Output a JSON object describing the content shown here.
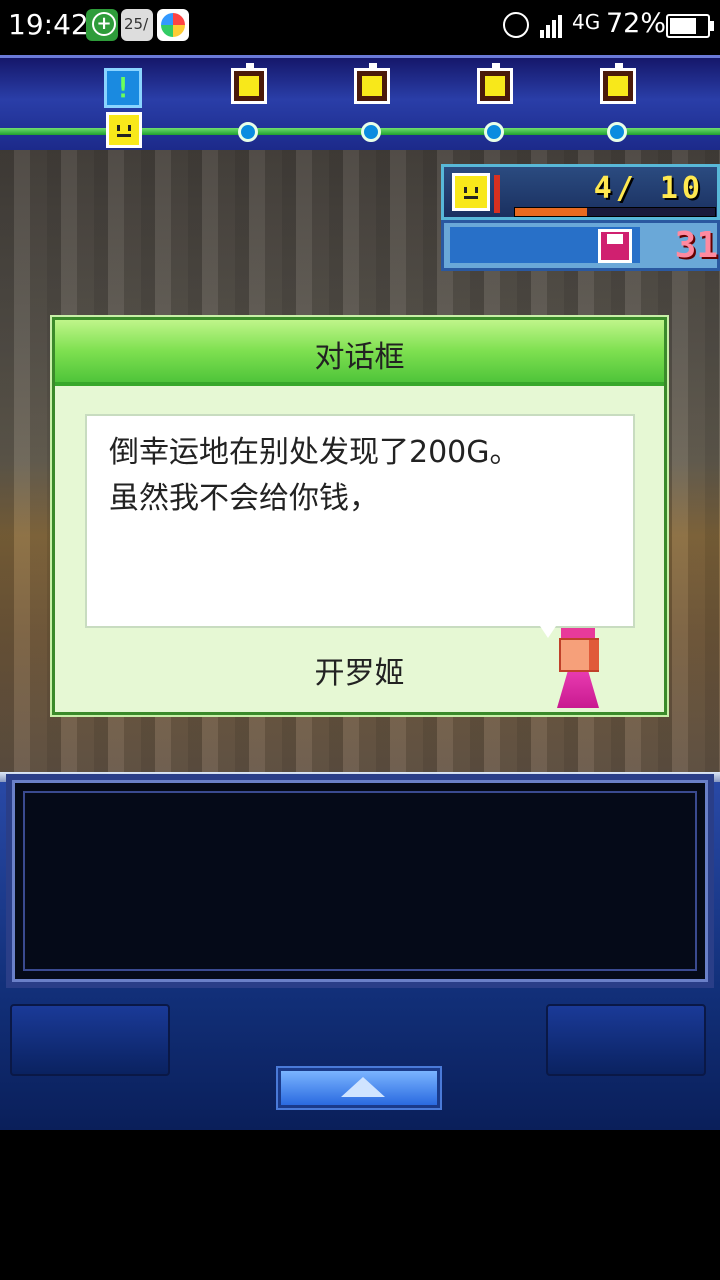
{
  "status_bar": {
    "time": "19:42",
    "calendar_day": "25/",
    "network": "4G",
    "battery_percent": "72%",
    "battery_level": 0.72,
    "icons": [
      "plus-circle-icon",
      "calendar-icon",
      "app-store-icon",
      "alarm-icon",
      "signal-icon",
      "battery-charging-icon"
    ]
  },
  "floor_progress": {
    "current_stage": 1,
    "stage_count": 5,
    "icons": [
      "exclamation-marker-icon",
      "smiley-face-icon",
      "treasure-chest-icon"
    ]
  },
  "hud": {
    "party_count": "4/ 10",
    "hp_fraction": 0.36,
    "floor_value": "31",
    "icons": [
      "smiley-face-icon",
      "floppy-disk-icon"
    ]
  },
  "dialog": {
    "title": "对话框",
    "message": "倒幸运地在别处发现了200G。\n虽然我不会给你钱，",
    "speaker": "开罗姬"
  },
  "controls": {
    "icons": [
      "up-arrow-icon"
    ]
  },
  "colors": {
    "dialog_header": "#7ee050",
    "dialog_body": "#e6f8d4",
    "panel_blue": "#12307a",
    "count_yellow": "#ffe850",
    "floor_pink": "#ff8aa0"
  }
}
